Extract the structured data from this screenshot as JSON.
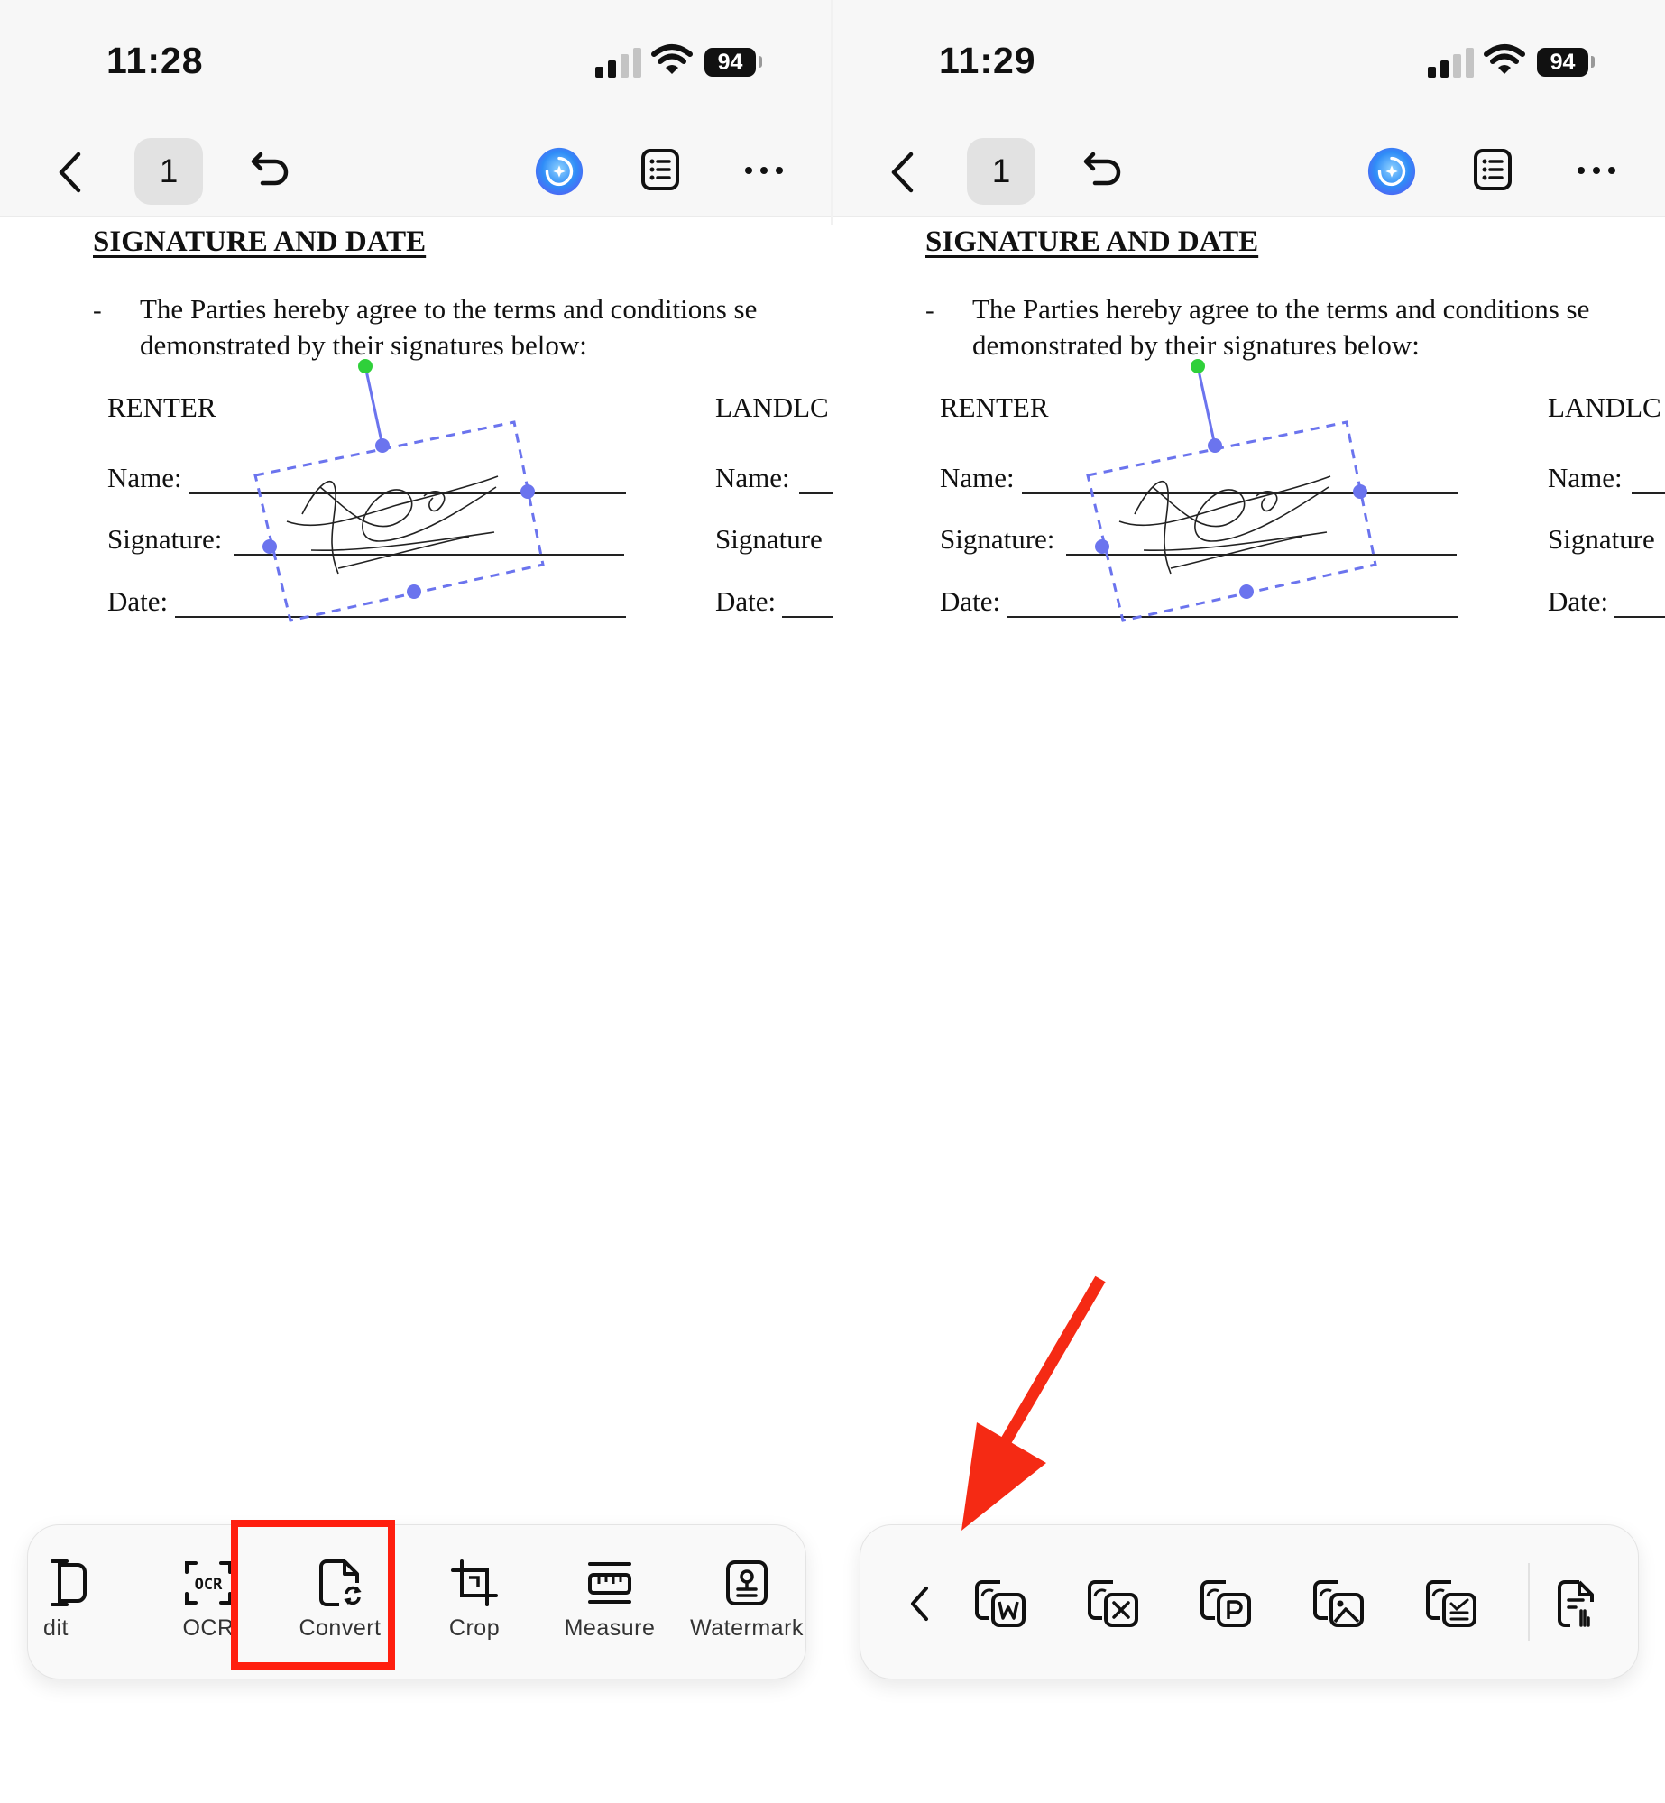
{
  "screens": [
    {
      "status": {
        "time": "11:28",
        "battery": "94"
      },
      "nav": {
        "page": "1"
      },
      "doc": {
        "heading": "SIGNATURE AND DATE",
        "dash": "-",
        "line1": "The Parties hereby agree to the terms and conditions se",
        "line2": "demonstrated by their signatures below:",
        "renter": "RENTER",
        "landlord": "LANDLC",
        "name_label": "Name:",
        "signature_label": "Signature:",
        "date_label": "Date:",
        "landlord_name_label": "Name:",
        "landlord_signature_label": "Signature",
        "landlord_date_label": "Date:"
      },
      "tools": [
        {
          "label": "dit",
          "icon": "edit-text-icon"
        },
        {
          "label": "OCR",
          "icon": "ocr-icon"
        },
        {
          "label": "Convert",
          "icon": "convert-icon"
        },
        {
          "label": "Crop",
          "icon": "crop-icon"
        },
        {
          "label": "Measure",
          "icon": "ruler-icon"
        },
        {
          "label": "Watermark",
          "icon": "watermark-icon"
        }
      ],
      "highlight_color": "#ff1f0f"
    },
    {
      "status": {
        "time": "11:29",
        "battery": "94"
      },
      "nav": {
        "page": "1"
      },
      "doc": {
        "heading": "SIGNATURE AND DATE",
        "dash": "-",
        "line1": "The Parties hereby agree to the terms and conditions se",
        "line2": "demonstrated by their signatures below:",
        "renter": "RENTER",
        "landlord": "LANDLC",
        "name_label": "Name:",
        "signature_label": "Signature:",
        "date_label": "Date:",
        "landlord_name_label": "Name:",
        "landlord_signature_label": "Signature",
        "landlord_date_label": "Date:"
      },
      "convert_tools": [
        {
          "icon": "pdf-to-word-icon"
        },
        {
          "icon": "pdf-to-excel-icon"
        },
        {
          "icon": "pdf-to-powerpoint-icon"
        },
        {
          "icon": "pdf-to-image-icon"
        },
        {
          "icon": "pdf-to-text-icon"
        },
        {
          "icon": "pdf-to-other-format-icon"
        }
      ],
      "annotation_arrow_color": "#f52a14"
    }
  ],
  "colors": {
    "accent": "#6b74ee",
    "rotate_handle": "#2fd03a",
    "ai_button": "#2f8df7"
  }
}
